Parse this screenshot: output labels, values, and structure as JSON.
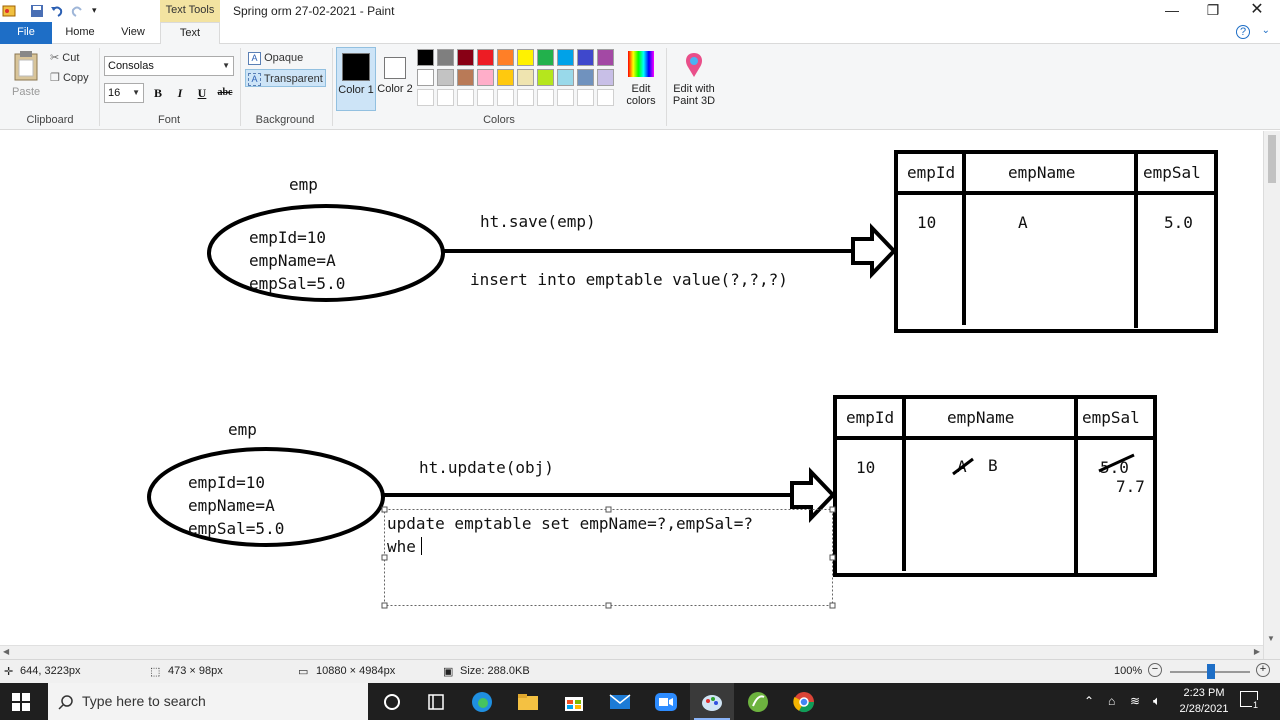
{
  "titlebar": {
    "context_tab": "Text Tools",
    "title": "Spring orm  27-02-2021 - Paint"
  },
  "tabs": [
    {
      "label": "File"
    },
    {
      "label": "Home"
    },
    {
      "label": "View"
    },
    {
      "label": "Text"
    }
  ],
  "ribbon": {
    "clipboard": {
      "paste": "Paste",
      "cut": "Cut",
      "copy": "Copy",
      "group": "Clipboard"
    },
    "font": {
      "family": "Consolas",
      "size": "16",
      "bold": "B",
      "italic": "I",
      "underline": "U",
      "strike": "abc",
      "group": "Font"
    },
    "background": {
      "opaque": "Opaque",
      "transparent": "Transparent",
      "group": "Background"
    },
    "colors": {
      "color1": "Color 1",
      "color2": "Color 2",
      "edit": "Edit colors",
      "paint3d": "Edit with Paint 3D",
      "group": "Colors",
      "palette_row1": [
        "#000000",
        "#7f7f7f",
        "#880015",
        "#ed1c24",
        "#ff7f27",
        "#fff200",
        "#22b14c",
        "#00a2e8",
        "#3f48cc",
        "#a349a4"
      ],
      "palette_row2": [
        "#ffffff",
        "#c3c3c3",
        "#b97a57",
        "#ffaec9",
        "#ffc90e",
        "#efe4b0",
        "#b5e61d",
        "#99d9ea",
        "#7092be",
        "#c8bfe7"
      ]
    }
  },
  "canvas": {
    "diagram1": {
      "obj_label": "emp",
      "fields": [
        "empId=10",
        "empName=A",
        "empSal=5.0"
      ],
      "method": "ht.save(emp)",
      "sql": "insert into emptable value(?,?,?)",
      "headers": [
        "empId",
        "empName",
        "empSal"
      ],
      "row": [
        "10",
        "A",
        "5.0"
      ]
    },
    "diagram2": {
      "obj_label": "emp",
      "fields": [
        "empId=10",
        "empName=A",
        "empSal=5.0"
      ],
      "method": "ht.update(obj)",
      "sql_line1": "update emptable set empName=?,empSal=?",
      "sql_line2": "whe",
      "headers": [
        "empId",
        "empName",
        "empSal"
      ],
      "id": "10",
      "old_name": "A",
      "new_name": "B",
      "old_sal": "5.0",
      "new_sal": "7.7"
    }
  },
  "status": {
    "cursor": "644, 3223px",
    "selection": "473 × 98px",
    "canvas_size": "10880 × 4984px",
    "file_size": "Size: 288.0KB",
    "zoom": "100%"
  },
  "taskbar": {
    "search_placeholder": "Type here to search",
    "time": "2:23 PM",
    "date": "2/28/2021",
    "notifications": "1"
  }
}
